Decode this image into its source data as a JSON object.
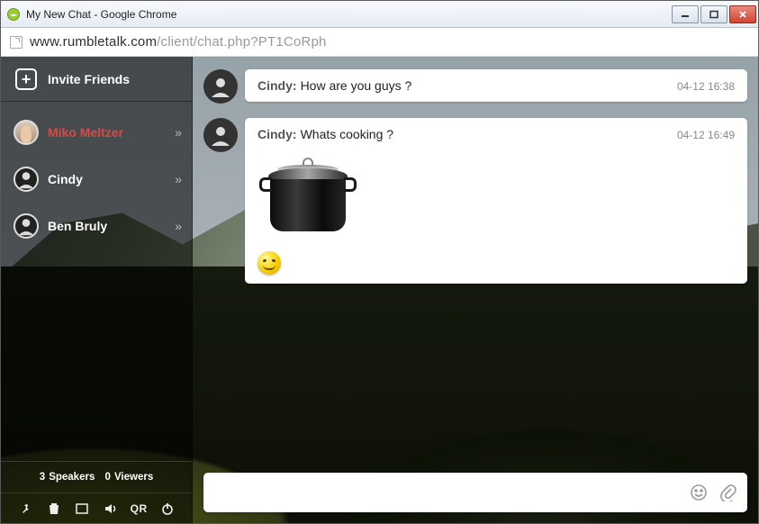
{
  "window": {
    "title": "My New Chat - Google Chrome"
  },
  "url": {
    "host": "www.rumbletalk.com",
    "path": "/client/chat.php?PT1CoRph"
  },
  "sidebar": {
    "invite_label": "Invite Friends",
    "users": [
      {
        "name": "Miko Meltzer",
        "selected": true,
        "avatar": "miko"
      },
      {
        "name": "Cindy",
        "selected": false,
        "avatar": "default"
      },
      {
        "name": "Ben Bruly",
        "selected": false,
        "avatar": "default"
      }
    ],
    "stats": {
      "speakers": "3",
      "speakers_label": "Speakers",
      "viewers": "0",
      "viewers_label": "Viewers"
    },
    "qr_label": "QR"
  },
  "messages": [
    {
      "sender": "Cindy:",
      "text": "How are you guys ?",
      "ts": "04-12 16:38",
      "has_attachment": false
    },
    {
      "sender": "Cindy:",
      "text": "Whats cooking ?",
      "ts": "04-12 16:49",
      "has_attachment": true
    }
  ],
  "input": {
    "placeholder": ""
  }
}
